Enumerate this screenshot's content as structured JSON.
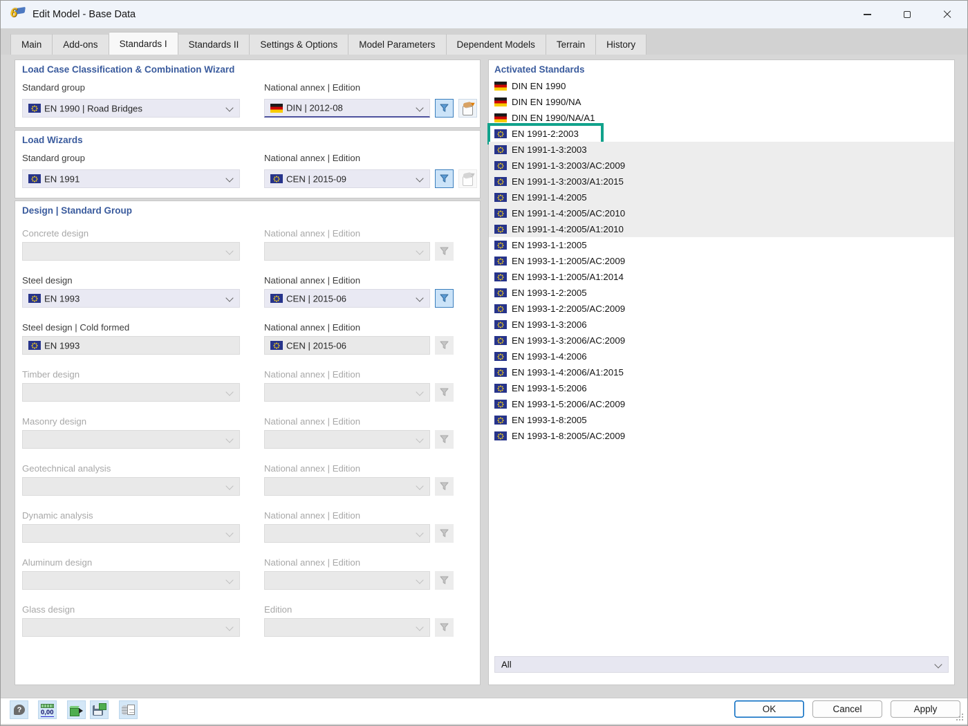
{
  "window": {
    "title": "Edit Model - Base Data",
    "icon_glyph": "6"
  },
  "tabs": {
    "items": [
      {
        "label": "Main",
        "cls": ""
      },
      {
        "label": "Add-ons",
        "cls": ""
      },
      {
        "label": "Standards I",
        "cls": "active"
      },
      {
        "label": "Standards II",
        "cls": ""
      },
      {
        "label": "Settings & Options",
        "cls": ""
      },
      {
        "label": "Model Parameters",
        "cls": ""
      },
      {
        "label": "Dependent Models",
        "cls": ""
      },
      {
        "label": "Terrain",
        "cls": ""
      },
      {
        "label": "History",
        "cls": ""
      }
    ]
  },
  "wizard1": {
    "title": "Load Case Classification & Combination Wizard",
    "sg_label": "Standard group",
    "sg_value": "EN 1990 | Road Bridges",
    "sg_flag": "eu",
    "annex_label": "National annex | Edition",
    "annex_value": "DIN | 2012-08",
    "annex_flag": "de"
  },
  "wizard2": {
    "title": "Load Wizards",
    "sg_label": "Standard group",
    "sg_value": "EN 1991",
    "sg_flag": "eu",
    "annex_label": "National annex | Edition",
    "annex_value": "CEN | 2015-09",
    "annex_flag": "eu"
  },
  "design": {
    "title": "Design | Standard Group",
    "rows": [
      {
        "label": "Concrete design",
        "value": "",
        "flag": "",
        "annex_label": "National annex | Edition",
        "annex_value": "",
        "annex_flag": "",
        "state": "disabled",
        "filter": "off",
        "inter": "false",
        "filter_inter": "false"
      },
      {
        "label": "Steel design",
        "value": "EN 1993",
        "flag": "eu",
        "annex_label": "National annex | Edition",
        "annex_value": "CEN | 2015-06",
        "annex_flag": "eu",
        "state": "enabled",
        "filter": "on",
        "inter": "true",
        "filter_inter": "true"
      },
      {
        "label": "Steel design | Cold formed",
        "value": "EN 1993",
        "flag": "eu",
        "annex_label": "National annex | Edition",
        "annex_value": "CEN | 2015-06",
        "annex_flag": "eu",
        "state": "readonly",
        "filter": "off",
        "inter": "false",
        "filter_inter": "false"
      },
      {
        "label": "Timber design",
        "value": "",
        "flag": "",
        "annex_label": "National annex | Edition",
        "annex_value": "",
        "annex_flag": "",
        "state": "disabled",
        "filter": "off",
        "inter": "false",
        "filter_inter": "false"
      },
      {
        "label": "Masonry design",
        "value": "",
        "flag": "",
        "annex_label": "National annex | Edition",
        "annex_value": "",
        "annex_flag": "",
        "state": "disabled",
        "filter": "off",
        "inter": "false",
        "filter_inter": "false"
      },
      {
        "label": "Geotechnical analysis",
        "value": "",
        "flag": "",
        "annex_label": "National annex | Edition",
        "annex_value": "",
        "annex_flag": "",
        "state": "disabled",
        "filter": "off",
        "inter": "false",
        "filter_inter": "false"
      },
      {
        "label": "Dynamic analysis",
        "value": "",
        "flag": "",
        "annex_label": "National annex | Edition",
        "annex_value": "",
        "annex_flag": "",
        "state": "disabled",
        "filter": "off",
        "inter": "false",
        "filter_inter": "false"
      },
      {
        "label": "Aluminum design",
        "value": "",
        "flag": "",
        "annex_label": "National annex | Edition",
        "annex_value": "",
        "annex_flag": "",
        "state": "disabled",
        "filter": "off",
        "inter": "false",
        "filter_inter": "false"
      },
      {
        "label": "Glass design",
        "value": "",
        "flag": "",
        "annex_label": "Edition",
        "annex_value": "",
        "annex_flag": "",
        "state": "disabled",
        "filter": "off",
        "inter": "false",
        "filter_inter": "false"
      }
    ]
  },
  "standards": {
    "title": "Activated Standards",
    "filter_value": "All",
    "items": [
      {
        "label": "DIN EN 1990",
        "flag": "de",
        "cls": ""
      },
      {
        "label": "DIN EN 1990/NA",
        "flag": "de",
        "cls": ""
      },
      {
        "label": "DIN EN 1990/NA/A1",
        "flag": "de",
        "cls": ""
      },
      {
        "label": "EN 1991-2:2003",
        "flag": "eu",
        "cls": "highlighted"
      },
      {
        "label": "EN 1991-1-3:2003",
        "flag": "eu",
        "cls": "ingray"
      },
      {
        "label": "EN 1991-1-3:2003/AC:2009",
        "flag": "eu",
        "cls": "ingray"
      },
      {
        "label": "EN 1991-1-3:2003/A1:2015",
        "flag": "eu",
        "cls": "ingray"
      },
      {
        "label": "EN 1991-1-4:2005",
        "flag": "eu",
        "cls": "ingray"
      },
      {
        "label": "EN 1991-1-4:2005/AC:2010",
        "flag": "eu",
        "cls": "ingray"
      },
      {
        "label": "EN 1991-1-4:2005/A1:2010",
        "flag": "eu",
        "cls": "ingray"
      },
      {
        "label": "EN 1993-1-1:2005",
        "flag": "eu",
        "cls": ""
      },
      {
        "label": "EN 1993-1-1:2005/AC:2009",
        "flag": "eu",
        "cls": ""
      },
      {
        "label": "EN 1993-1-1:2005/A1:2014",
        "flag": "eu",
        "cls": ""
      },
      {
        "label": "EN 1993-1-2:2005",
        "flag": "eu",
        "cls": ""
      },
      {
        "label": "EN 1993-1-2:2005/AC:2009",
        "flag": "eu",
        "cls": ""
      },
      {
        "label": "EN 1993-1-3:2006",
        "flag": "eu",
        "cls": ""
      },
      {
        "label": "EN 1993-1-3:2006/AC:2009",
        "flag": "eu",
        "cls": ""
      },
      {
        "label": "EN 1993-1-4:2006",
        "flag": "eu",
        "cls": ""
      },
      {
        "label": "EN 1993-1-4:2006/A1:2015",
        "flag": "eu",
        "cls": ""
      },
      {
        "label": "EN 1993-1-5:2006",
        "flag": "eu",
        "cls": ""
      },
      {
        "label": "EN 1993-1-5:2006/AC:2009",
        "flag": "eu",
        "cls": ""
      },
      {
        "label": "EN 1993-1-8:2005",
        "flag": "eu",
        "cls": ""
      },
      {
        "label": "EN 1993-1-8:2005/AC:2009",
        "flag": "eu",
        "cls": ""
      }
    ]
  },
  "toolbar": {
    "help_glyph": "?",
    "units_glyph": "0,00"
  },
  "footer": {
    "ok": "OK",
    "cancel": "Cancel",
    "apply": "Apply"
  },
  "colors": {
    "accent_blue": "#3a5b9d",
    "highlight_teal": "#11a28b",
    "filter_active": "#5b9bd5",
    "eu_flag_blue": "#27348b",
    "focus_underline": "#4d519d"
  }
}
